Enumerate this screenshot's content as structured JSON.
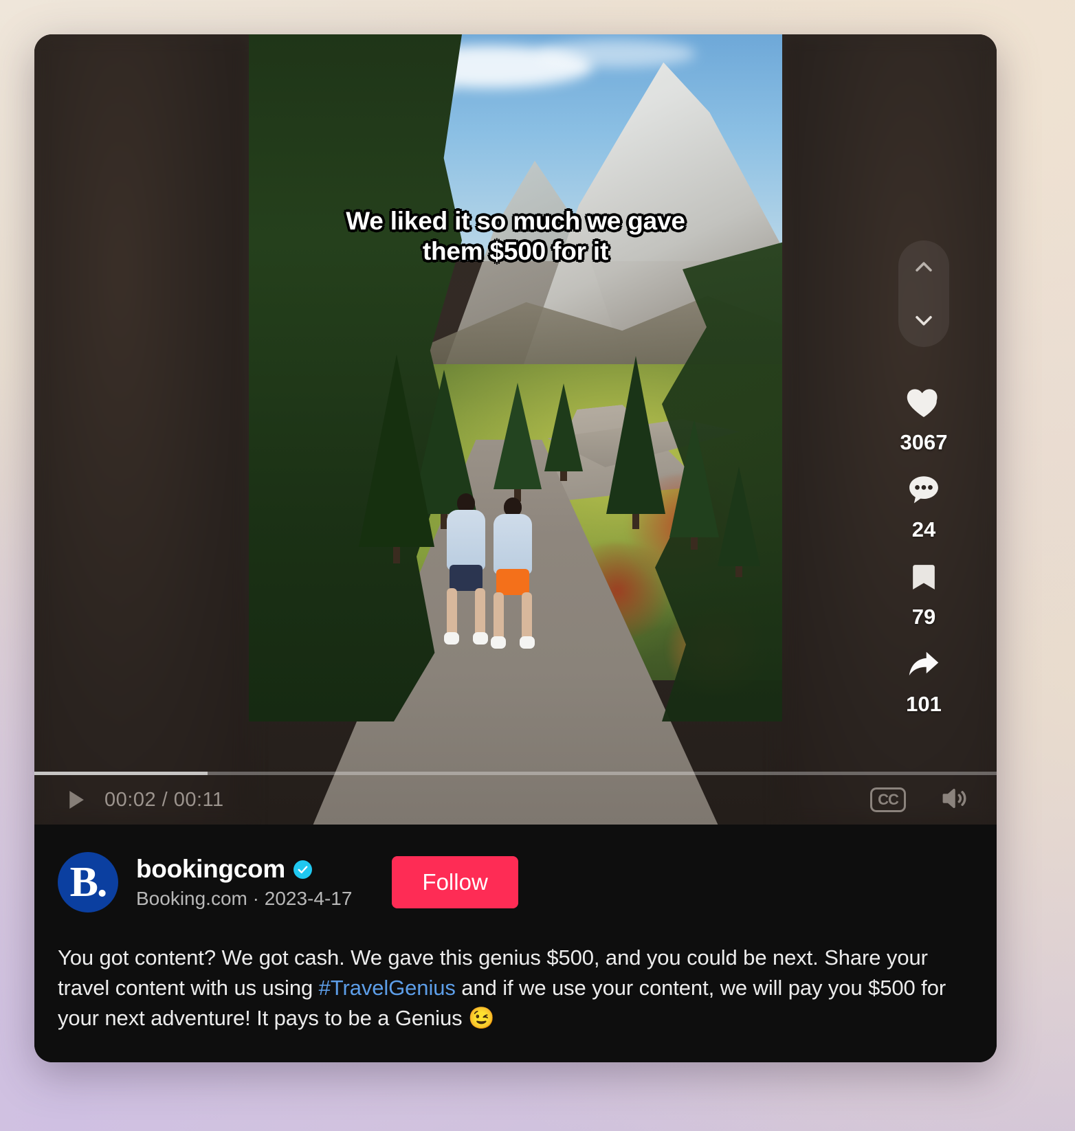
{
  "video": {
    "subtitle_line1": "We liked it so much we gave",
    "subtitle_line2": "them $500 for it",
    "nav_up_icon": "chevron-up-icon",
    "nav_down_icon": "chevron-down-icon"
  },
  "actions": {
    "like": {
      "icon": "heart-icon",
      "count": "3067"
    },
    "comment": {
      "icon": "comment-icon",
      "count": "24"
    },
    "bookmark": {
      "icon": "bookmark-icon",
      "count": "79"
    },
    "share": {
      "icon": "share-arrow-icon",
      "count": "101"
    }
  },
  "controls": {
    "play_icon": "play-icon",
    "time": "00:02 / 00:11",
    "current_time": "00:02",
    "duration": "00:11",
    "cc_label": "CC",
    "volume_icon": "speaker-icon",
    "progress_percent": 18
  },
  "author": {
    "avatar_glyph": "B.",
    "username": "bookingcom",
    "verified_icon": "verified-check-icon",
    "display_name": "Booking.com",
    "separator": "·",
    "date": "2023-4-17",
    "follow_label": "Follow"
  },
  "caption": {
    "part1": "You got content? We got cash. We gave this genius $500, and you could be next. Share your travel content with us using ",
    "hashtag": "#TravelGenius",
    "part2": " and if we use your content, we will pay you $500 for your next adventure! It pays to be a Genius 😉"
  },
  "colors": {
    "follow_red": "#fe2c55",
    "verified_blue": "#20c8f0",
    "hashtag_blue": "#5d9ee8",
    "avatar_blue": "#0b3fa0"
  }
}
